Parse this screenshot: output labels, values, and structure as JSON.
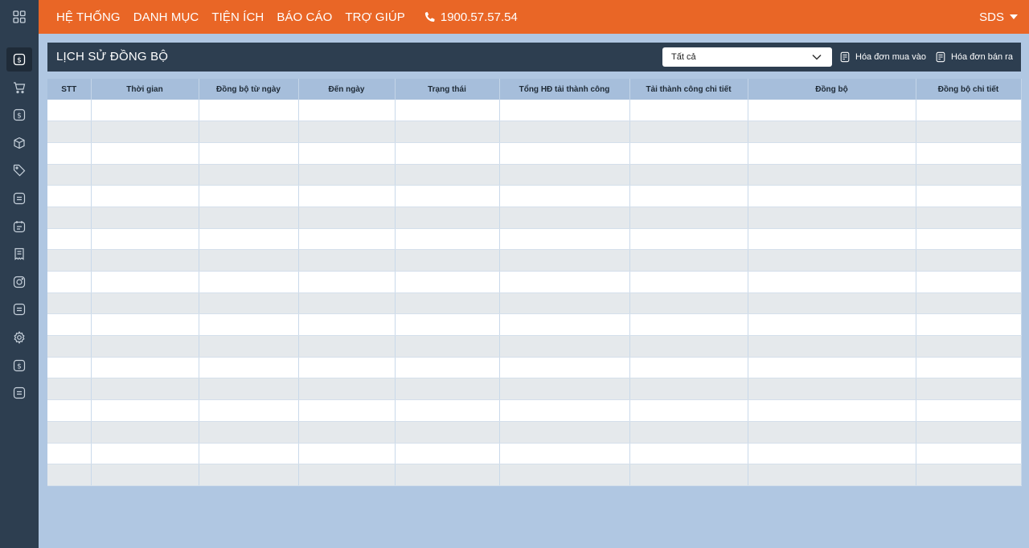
{
  "sidebar": {
    "items": [
      {
        "icon": "dollar-circle-icon",
        "active": true
      },
      {
        "icon": "cart-icon"
      },
      {
        "icon": "dollar-circle-icon"
      },
      {
        "icon": "box-icon"
      },
      {
        "icon": "tag-icon"
      },
      {
        "icon": "list-icon"
      },
      {
        "icon": "calendar-list-icon"
      },
      {
        "icon": "receipt-icon"
      },
      {
        "icon": "instagram-icon"
      },
      {
        "icon": "list-icon"
      },
      {
        "icon": "gear-icon"
      },
      {
        "icon": "dollar-circle-icon"
      },
      {
        "icon": "list-icon"
      }
    ]
  },
  "topbar": {
    "menu": [
      "HỆ THỐNG",
      "DANH MỤC",
      "TIỆN ÍCH",
      "BÁO CÁO",
      "TRỢ GIÚP"
    ],
    "hotline": "1900.57.57.54",
    "user": "SDS"
  },
  "panel": {
    "title": "LỊCH SỬ ĐỒNG BỘ",
    "filter": {
      "selected": "Tất cả"
    },
    "buttons": {
      "purchase_invoice": "Hóa đơn mua vào",
      "sales_invoice": "Hóa đơn bán ra"
    }
  },
  "table": {
    "columns": [
      "STT",
      "Thời gian",
      "Đồng bộ từ ngày",
      "Đến ngày",
      "Trạng thái",
      "Tổng HĐ tải thành công",
      "Tải thành công chi tiết",
      "Đồng bộ",
      "Đồng bộ chi tiết"
    ],
    "rows": []
  },
  "colors": {
    "topbar": "#e96626",
    "sidebar": "#2d3e50",
    "background": "#b0c7e2",
    "table_header": "#a6bedb"
  }
}
